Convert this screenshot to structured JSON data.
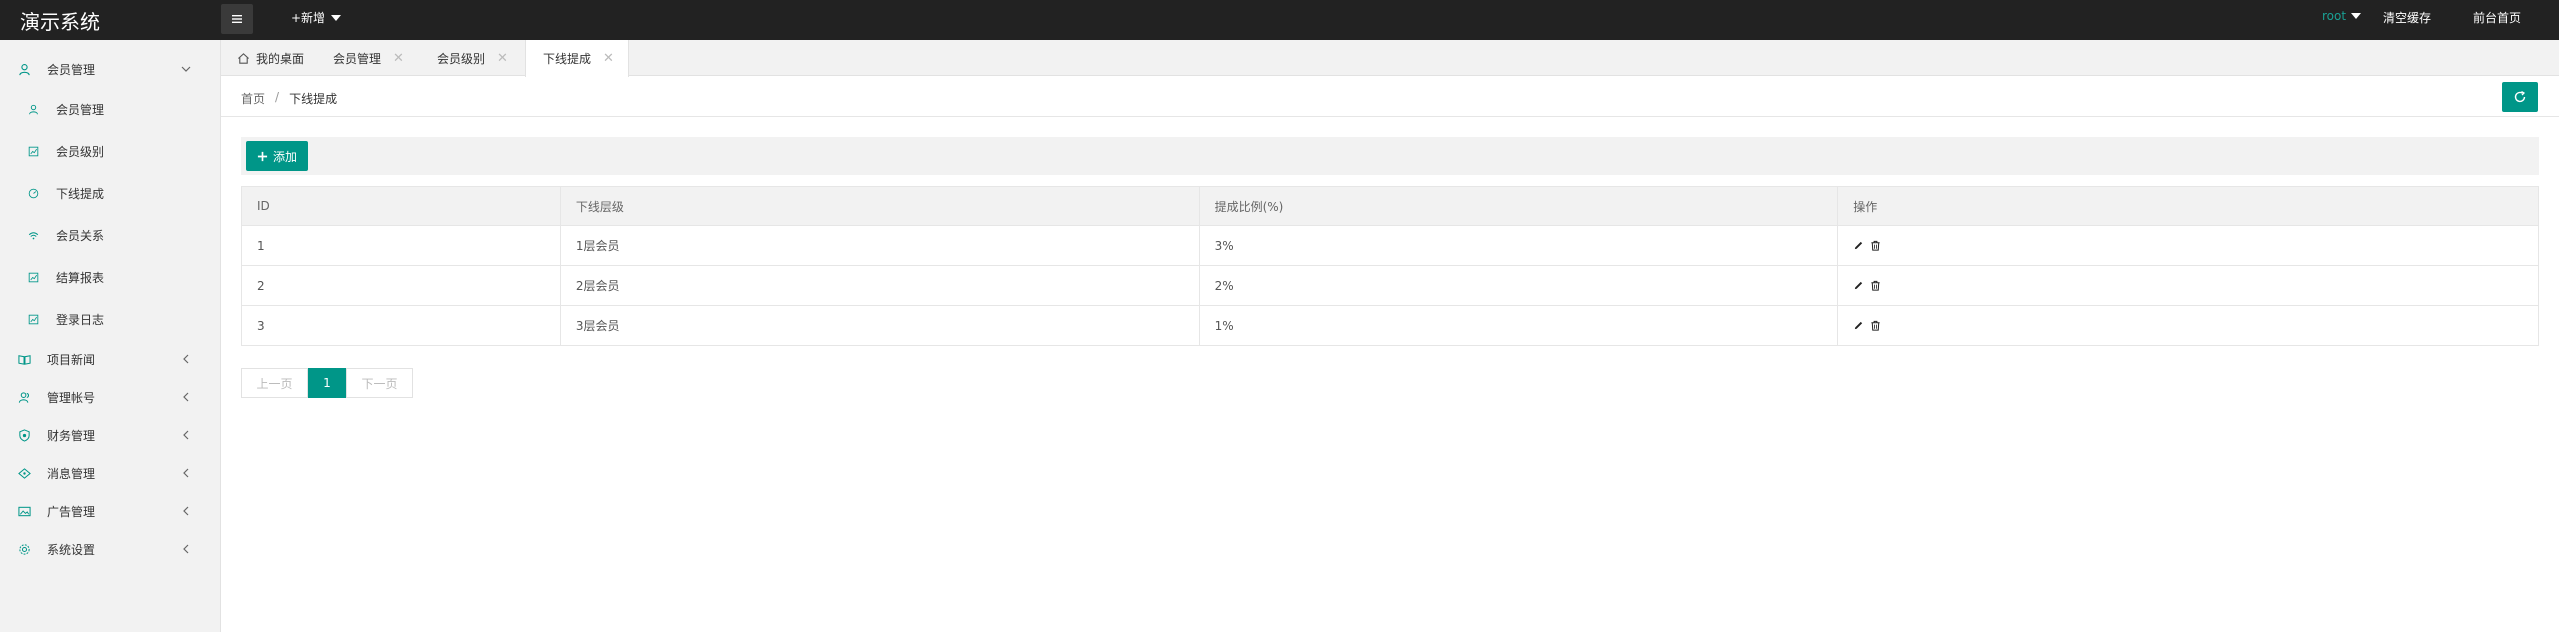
{
  "app": {
    "title": "演示系统",
    "new_label": "+新增"
  },
  "header": {
    "user": "root",
    "clear_cache": "清空缓存",
    "frontend_home": "前台首页"
  },
  "sidebar": {
    "groups": [
      {
        "label": "会员管理",
        "icon": "user-icon",
        "expanded": true
      },
      {
        "label": "项目新闻",
        "icon": "book-icon"
      },
      {
        "label": "管理帐号",
        "icon": "user-group-icon"
      },
      {
        "label": "财务管理",
        "icon": "shield-icon"
      },
      {
        "label": "消息管理",
        "icon": "message-icon"
      },
      {
        "label": "广告管理",
        "icon": "image-icon"
      },
      {
        "label": "系统设置",
        "icon": "gear-icon"
      }
    ],
    "sub_items": [
      {
        "label": "会员管理",
        "icon": "user-icon"
      },
      {
        "label": "会员级别",
        "icon": "chart-icon"
      },
      {
        "label": "下线提成",
        "icon": "gauge-icon"
      },
      {
        "label": "会员关系",
        "icon": "wifi-icon"
      },
      {
        "label": "结算报表",
        "icon": "chart-icon"
      },
      {
        "label": "登录日志",
        "icon": "chart-icon"
      }
    ]
  },
  "tabs": [
    {
      "label": "我的桌面",
      "icon": "home-icon"
    },
    {
      "label": "会员管理"
    },
    {
      "label": "会员级别"
    },
    {
      "label": "下线提成",
      "active": true
    }
  ],
  "breadcrumb": {
    "home": "首页",
    "sep": "/",
    "current": "下线提成"
  },
  "toolbar": {
    "add_label": "添加"
  },
  "table": {
    "columns": [
      "ID",
      "下线层级",
      "提成比例(%)",
      "操作"
    ],
    "rows": [
      {
        "id": "1",
        "level": "1层会员",
        "ratio": "3%"
      },
      {
        "id": "2",
        "level": "2层会员",
        "ratio": "2%"
      },
      {
        "id": "3",
        "level": "3层会员",
        "ratio": "1%"
      }
    ]
  },
  "pager": {
    "prev": "上一页",
    "current": "1",
    "next": "下一页"
  },
  "colors": {
    "accent": "#009688",
    "topbar": "#222222",
    "user": "#1aa094"
  }
}
